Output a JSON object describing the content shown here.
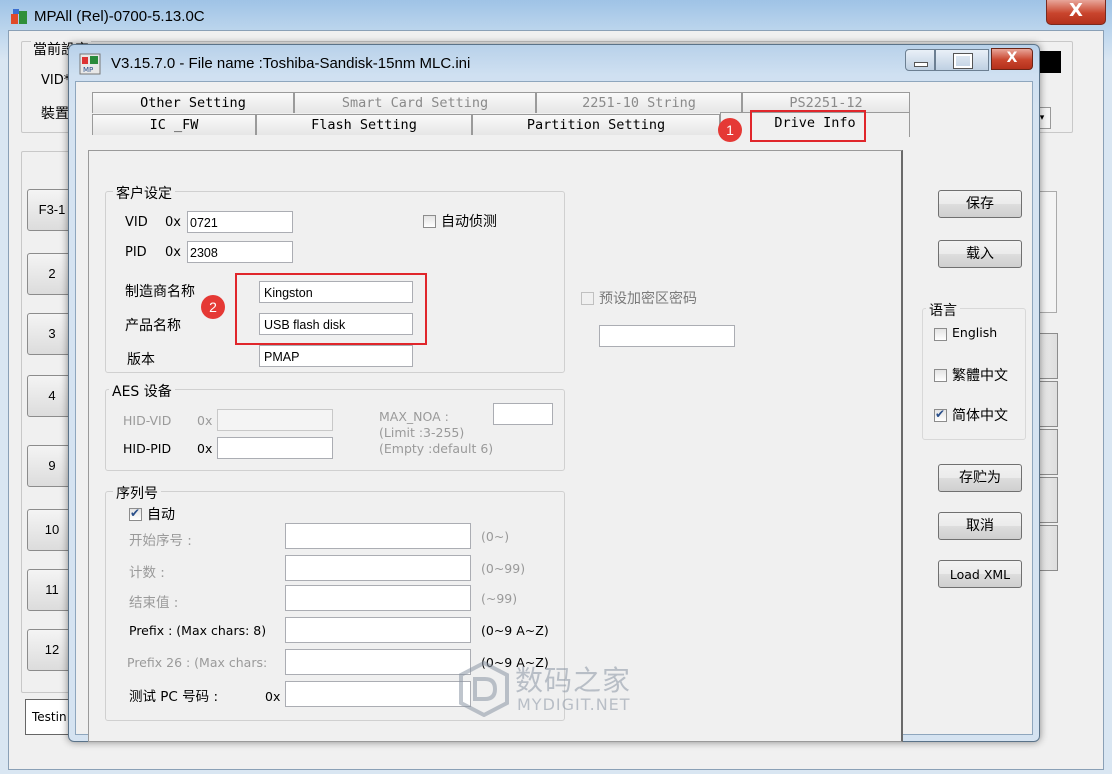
{
  "back_window": {
    "title": "MPAll (Rel)-0700-5.13.0C",
    "close_label": "X",
    "group_label": "當前設定",
    "vid_label": "VID*",
    "device_label": "裝置",
    "slot_first": "F3-1",
    "slots": [
      "2",
      "3",
      "4",
      "9",
      "10",
      "11",
      "12"
    ],
    "testing_label": "Testin"
  },
  "dialog": {
    "title": "V3.15.7.0 - File name :Toshiba-Sandisk-15nm MLC.ini",
    "close_label": "X",
    "tabs_row1": [
      "Other Setting",
      "Smart Card Setting",
      "2251-10 String",
      "PS2251-12"
    ],
    "tabs_row2": [
      "IC _FW",
      "Flash Setting",
      "Partition Setting",
      "Drive Info"
    ],
    "active_tab": "Drive Info",
    "customer": {
      "title": "客户设定",
      "vid_label": "VID",
      "vid_prefix": "0x",
      "vid_value": "0721",
      "pid_label": "PID",
      "pid_prefix": "0x",
      "pid_value": "2308",
      "auto_detect_label": "自动侦测",
      "manufacturer_label": "制造商名称",
      "manufacturer_value": "Kingston",
      "product_label": "产品名称",
      "product_value": "USB flash disk",
      "version_label": "版本",
      "version_value": "PMAP"
    },
    "preset_password_label": "预设加密区密码",
    "aes": {
      "title": "AES 设备",
      "hid_vid_label": "HID-VID",
      "hid_vid_prefix": "0x",
      "hid_pid_label": "HID-PID",
      "hid_pid_prefix": "0x",
      "max_noa_label": "MAX_NOA :",
      "limit_label": "(Limit :3-255)",
      "empty_label": "(Empty :default 6)"
    },
    "serial": {
      "title": "序列号",
      "auto_label": "自动",
      "start_label": "开始序号 :",
      "start_hint": "(0~)",
      "count_label": "计数 :",
      "count_hint": "(0~99)",
      "end_label": "结束值 :",
      "end_hint": "(~99)",
      "prefix_label": "Prefix : (Max chars: 8)",
      "prefix_hint": "(0~9 A~Z)",
      "prefix26_label": "Prefix 26 : (Max chars:",
      "prefix26_hint": "(0~9 A~Z)",
      "test_pc_label": "测试 PC 号码 :",
      "test_pc_prefix": "0x"
    },
    "buttons": {
      "save": "保存",
      "load": "载入",
      "save_as": "存贮为",
      "cancel": "取消",
      "load_xml": "Load XML"
    },
    "language": {
      "title": "语言",
      "options": [
        {
          "label": "English",
          "checked": false
        },
        {
          "label": "繁體中文",
          "checked": false
        },
        {
          "label": "简体中文",
          "checked": true
        }
      ]
    },
    "annotations": [
      "1",
      "2"
    ]
  },
  "watermark": {
    "cn": "数码之家",
    "en": "MYDIGIT.NET"
  },
  "colors": {
    "annotation_red": "#e0262b",
    "title_gradient_top": "#b8d1ea",
    "close_red": "#c9452d"
  }
}
